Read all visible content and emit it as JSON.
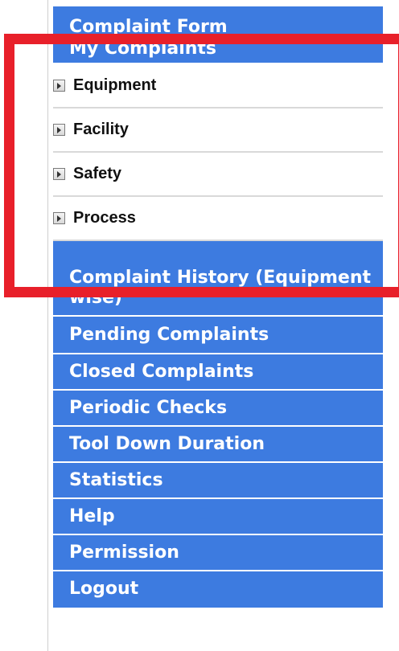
{
  "menu": {
    "complaint_form": "Complaint Form",
    "my_complaints": "My Complaints",
    "submenu": [
      {
        "label": "Equipment"
      },
      {
        "label": "Facility"
      },
      {
        "label": "Safety"
      },
      {
        "label": "Process"
      }
    ],
    "complaint_history": "Complaint History (Equipment wise)",
    "pending_complaints": "Pending Complaints",
    "closed_complaints": "Closed Complaints",
    "periodic_checks": "Periodic Checks",
    "tool_down_duration": "Tool Down Duration",
    "statistics": "Statistics",
    "help": "Help",
    "permission": "Permission",
    "logout": "Logout"
  },
  "colors": {
    "menu_background": "#3d7be0",
    "highlight_border": "#e8202a",
    "submenu_background": "#ffffff"
  }
}
